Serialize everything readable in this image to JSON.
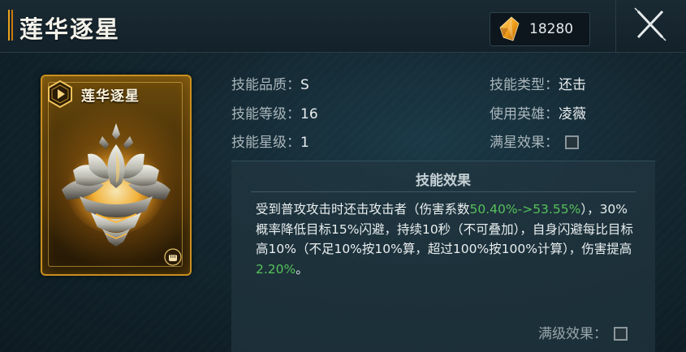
{
  "header": {
    "title": "莲华逐星",
    "currency_value": "18280",
    "currency_icon": "crystal-icon",
    "close_icon": "close-icon"
  },
  "card": {
    "title": "莲华逐星",
    "badge_icon": "play-badge-icon",
    "art_icon": "golden-lotus-icon",
    "type_icon": "fist-icon"
  },
  "attributes": {
    "quality_label": "技能品质：",
    "quality_value": "S",
    "level_label": "技能等级：",
    "level_value": "16",
    "star_label": "技能星级：",
    "star_value": "1",
    "type_label": "技能类型：",
    "type_value": "还击",
    "hero_label": "使用英雄：",
    "hero_value": "凌薇",
    "full_star_label": "满星效果："
  },
  "effects": {
    "title": "技能效果",
    "text_1": "受到普攻攻击时还击攻击者（伤害系数",
    "highlight_1": "50.40%->53.55%",
    "text_2": "），30%概率降低目标15%闪避，持续10秒（不可叠加），自身闪避每比目标高10%（不足10%按10%算，超过100%按100%计算），伤害提高",
    "highlight_2": "2.20%",
    "text_3": "。",
    "max_level_label": "满级效果："
  },
  "colors": {
    "accent_gold": "#e8a21d",
    "highlight_green": "#57c15b",
    "background": "#13262f"
  }
}
